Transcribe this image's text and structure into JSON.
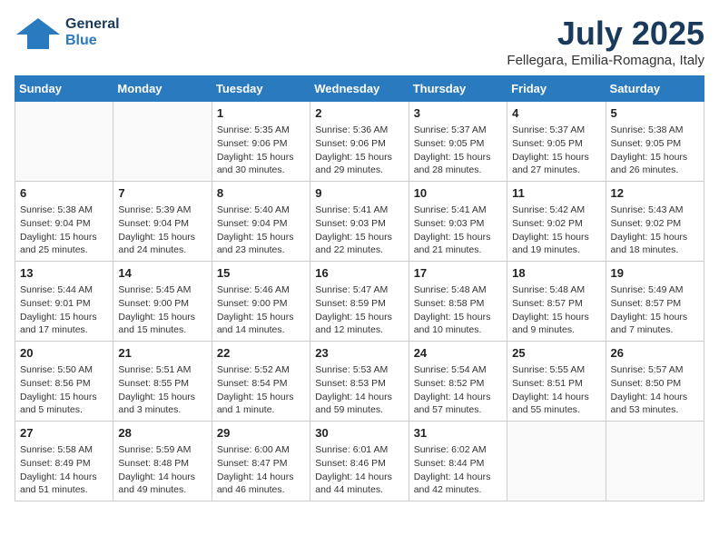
{
  "header": {
    "logo_line1": "General",
    "logo_line2": "Blue",
    "month": "July 2025",
    "location": "Fellegara, Emilia-Romagna, Italy"
  },
  "days_of_week": [
    "Sunday",
    "Monday",
    "Tuesday",
    "Wednesday",
    "Thursday",
    "Friday",
    "Saturday"
  ],
  "weeks": [
    [
      {
        "day": "",
        "info": ""
      },
      {
        "day": "",
        "info": ""
      },
      {
        "day": "1",
        "sunrise": "5:35 AM",
        "sunset": "9:06 PM",
        "daylight": "15 hours and 30 minutes."
      },
      {
        "day": "2",
        "sunrise": "5:36 AM",
        "sunset": "9:06 PM",
        "daylight": "15 hours and 29 minutes."
      },
      {
        "day": "3",
        "sunrise": "5:37 AM",
        "sunset": "9:05 PM",
        "daylight": "15 hours and 28 minutes."
      },
      {
        "day": "4",
        "sunrise": "5:37 AM",
        "sunset": "9:05 PM",
        "daylight": "15 hours and 27 minutes."
      },
      {
        "day": "5",
        "sunrise": "5:38 AM",
        "sunset": "9:05 PM",
        "daylight": "15 hours and 26 minutes."
      }
    ],
    [
      {
        "day": "6",
        "sunrise": "5:38 AM",
        "sunset": "9:04 PM",
        "daylight": "15 hours and 25 minutes."
      },
      {
        "day": "7",
        "sunrise": "5:39 AM",
        "sunset": "9:04 PM",
        "daylight": "15 hours and 24 minutes."
      },
      {
        "day": "8",
        "sunrise": "5:40 AM",
        "sunset": "9:04 PM",
        "daylight": "15 hours and 23 minutes."
      },
      {
        "day": "9",
        "sunrise": "5:41 AM",
        "sunset": "9:03 PM",
        "daylight": "15 hours and 22 minutes."
      },
      {
        "day": "10",
        "sunrise": "5:41 AM",
        "sunset": "9:03 PM",
        "daylight": "15 hours and 21 minutes."
      },
      {
        "day": "11",
        "sunrise": "5:42 AM",
        "sunset": "9:02 PM",
        "daylight": "15 hours and 19 minutes."
      },
      {
        "day": "12",
        "sunrise": "5:43 AM",
        "sunset": "9:02 PM",
        "daylight": "15 hours and 18 minutes."
      }
    ],
    [
      {
        "day": "13",
        "sunrise": "5:44 AM",
        "sunset": "9:01 PM",
        "daylight": "15 hours and 17 minutes."
      },
      {
        "day": "14",
        "sunrise": "5:45 AM",
        "sunset": "9:00 PM",
        "daylight": "15 hours and 15 minutes."
      },
      {
        "day": "15",
        "sunrise": "5:46 AM",
        "sunset": "9:00 PM",
        "daylight": "15 hours and 14 minutes."
      },
      {
        "day": "16",
        "sunrise": "5:47 AM",
        "sunset": "8:59 PM",
        "daylight": "15 hours and 12 minutes."
      },
      {
        "day": "17",
        "sunrise": "5:48 AM",
        "sunset": "8:58 PM",
        "daylight": "15 hours and 10 minutes."
      },
      {
        "day": "18",
        "sunrise": "5:48 AM",
        "sunset": "8:57 PM",
        "daylight": "15 hours and 9 minutes."
      },
      {
        "day": "19",
        "sunrise": "5:49 AM",
        "sunset": "8:57 PM",
        "daylight": "15 hours and 7 minutes."
      }
    ],
    [
      {
        "day": "20",
        "sunrise": "5:50 AM",
        "sunset": "8:56 PM",
        "daylight": "15 hours and 5 minutes."
      },
      {
        "day": "21",
        "sunrise": "5:51 AM",
        "sunset": "8:55 PM",
        "daylight": "15 hours and 3 minutes."
      },
      {
        "day": "22",
        "sunrise": "5:52 AM",
        "sunset": "8:54 PM",
        "daylight": "15 hours and 1 minute."
      },
      {
        "day": "23",
        "sunrise": "5:53 AM",
        "sunset": "8:53 PM",
        "daylight": "14 hours and 59 minutes."
      },
      {
        "day": "24",
        "sunrise": "5:54 AM",
        "sunset": "8:52 PM",
        "daylight": "14 hours and 57 minutes."
      },
      {
        "day": "25",
        "sunrise": "5:55 AM",
        "sunset": "8:51 PM",
        "daylight": "14 hours and 55 minutes."
      },
      {
        "day": "26",
        "sunrise": "5:57 AM",
        "sunset": "8:50 PM",
        "daylight": "14 hours and 53 minutes."
      }
    ],
    [
      {
        "day": "27",
        "sunrise": "5:58 AM",
        "sunset": "8:49 PM",
        "daylight": "14 hours and 51 minutes."
      },
      {
        "day": "28",
        "sunrise": "5:59 AM",
        "sunset": "8:48 PM",
        "daylight": "14 hours and 49 minutes."
      },
      {
        "day": "29",
        "sunrise": "6:00 AM",
        "sunset": "8:47 PM",
        "daylight": "14 hours and 46 minutes."
      },
      {
        "day": "30",
        "sunrise": "6:01 AM",
        "sunset": "8:46 PM",
        "daylight": "14 hours and 44 minutes."
      },
      {
        "day": "31",
        "sunrise": "6:02 AM",
        "sunset": "8:44 PM",
        "daylight": "14 hours and 42 minutes."
      },
      {
        "day": "",
        "info": ""
      },
      {
        "day": "",
        "info": ""
      }
    ]
  ]
}
